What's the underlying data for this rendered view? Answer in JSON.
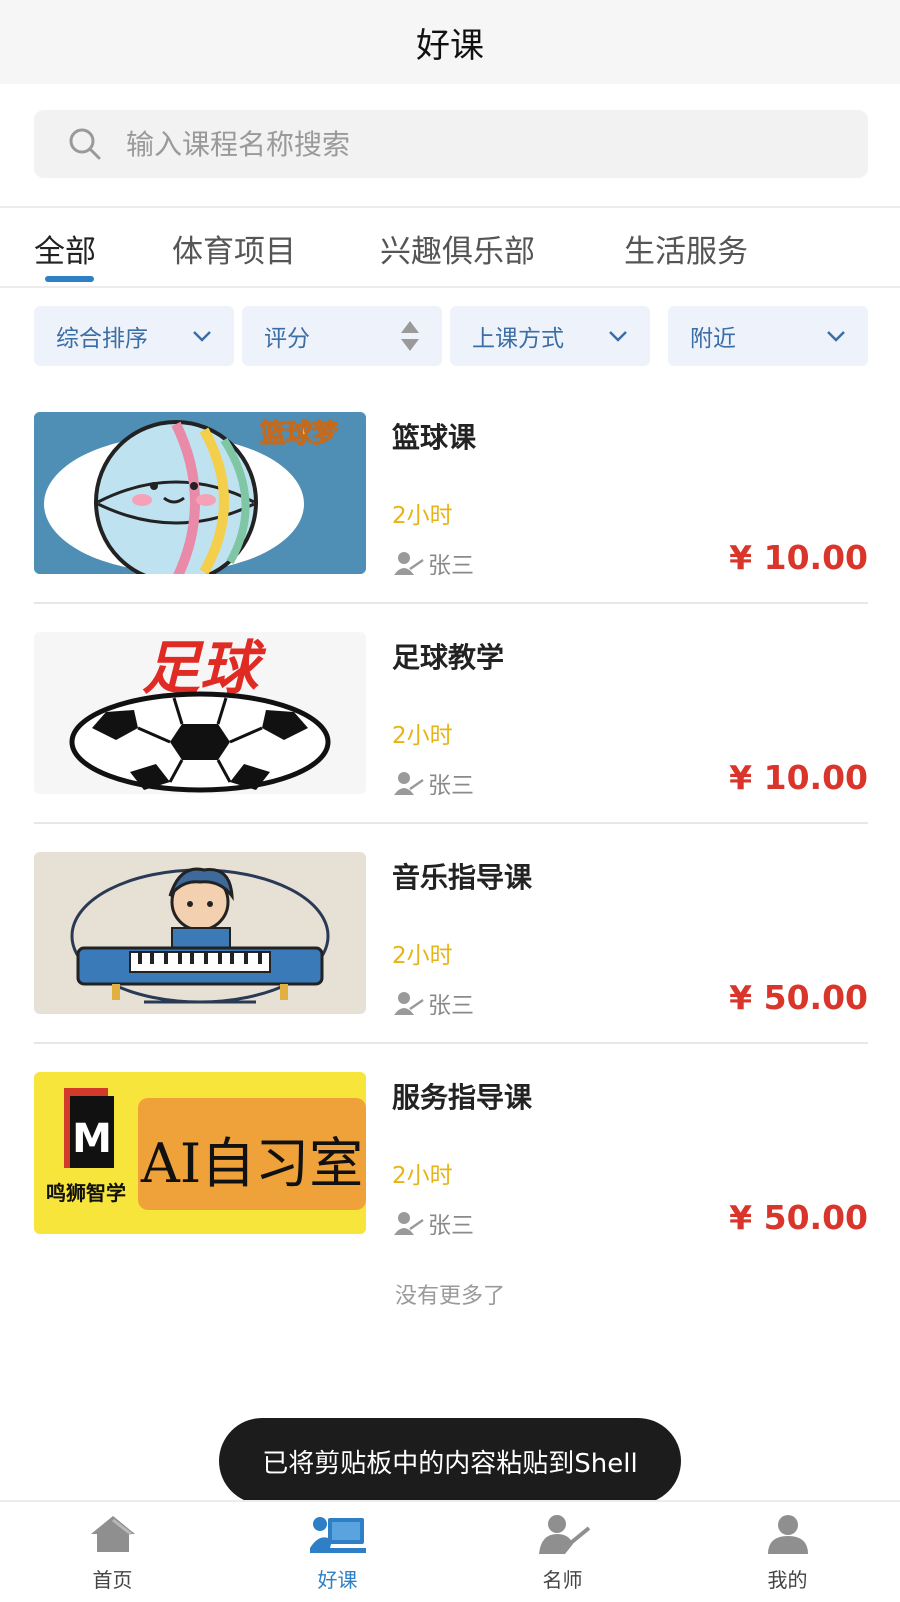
{
  "header": {
    "title": "好课"
  },
  "search": {
    "placeholder": "输入课程名称搜索"
  },
  "tabs": [
    {
      "label": "全部",
      "active": true
    },
    {
      "label": "体育项目"
    },
    {
      "label": "兴趣俱乐部"
    },
    {
      "label": "生活服务"
    }
  ],
  "filters": [
    {
      "label": "综合排序",
      "icon": "chevron-down-icon"
    },
    {
      "label": "评分",
      "icon": "sort-icon"
    },
    {
      "label": "上课方式",
      "icon": "chevron-down-icon"
    },
    {
      "label": "附近",
      "icon": "chevron-down-icon"
    }
  ],
  "courses": [
    {
      "name": "篮球课",
      "duration": "2小时",
      "teacher": "张三",
      "price": "¥ 10.00",
      "thumb_text": "篮球梦"
    },
    {
      "name": "足球教学",
      "duration": "2小时",
      "teacher": "张三",
      "price": "¥ 10.00",
      "thumb_text": "足球"
    },
    {
      "name": "音乐指导课",
      "duration": "2小时",
      "teacher": "张三",
      "price": "¥ 50.00"
    },
    {
      "name": "服务指导课",
      "duration": "2小时",
      "teacher": "张三",
      "price": "¥ 50.00",
      "thumb_text": "AI自习室",
      "thumb_brand": "鸣狮智学",
      "thumb_logo": "M"
    }
  ],
  "list_end": "没有更多了",
  "toast": "已将剪贴板中的内容粘贴到Shell",
  "tabbar": [
    {
      "label": "首页",
      "icon": "home-icon"
    },
    {
      "label": "好课",
      "icon": "course-icon",
      "active": true
    },
    {
      "label": "名师",
      "icon": "teacher-icon"
    },
    {
      "label": "我的",
      "icon": "profile-icon"
    }
  ],
  "colors": {
    "accent": "#2f7fc7",
    "price": "#d9352b",
    "duration": "#e6b417",
    "filter_bg": "#eef3fb"
  }
}
